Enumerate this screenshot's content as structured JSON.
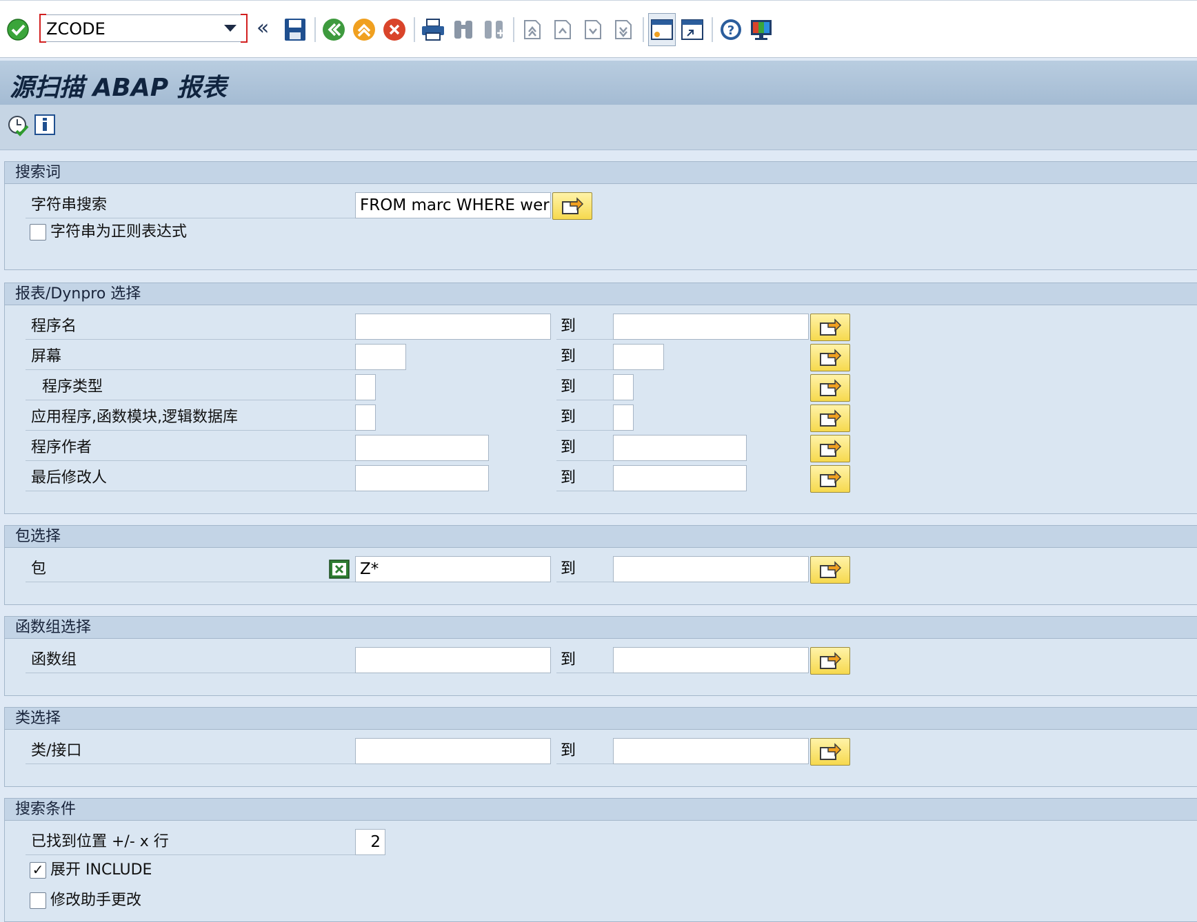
{
  "toolbar": {
    "command_value": "ZCODE",
    "icons": [
      "enter-icon",
      "save-icon",
      "back-icon",
      "exit-icon",
      "cancel-icon",
      "print-icon",
      "find-icon",
      "find-next-icon",
      "first-page-icon",
      "previous-page-icon",
      "next-page-icon",
      "last-page-icon",
      "create-session-icon",
      "shortcut-icon",
      "help-icon",
      "customize-layout-icon"
    ]
  },
  "title": "源扫描 ABAP 报表",
  "app_toolbar": {
    "icons": [
      "execute-icon",
      "information-icon"
    ]
  },
  "groups": {
    "search_terms": {
      "title": "搜索词",
      "string_search_label": "字符串搜索",
      "string_search_value": "FROM marc WHERE wer…",
      "regex_label": "字符串为正则表达式",
      "regex_checked": false
    },
    "report_selection": {
      "title": "报表/Dynpro 选择",
      "to_label": "到",
      "rows": [
        {
          "label": "程序名",
          "from": "",
          "to": ""
        },
        {
          "label": "屏幕",
          "from": "",
          "to": ""
        },
        {
          "label": "程序类型",
          "from": "",
          "to": ""
        },
        {
          "label": "应用程序,函数模块,逻辑数据库",
          "from": "",
          "to": ""
        },
        {
          "label": "程序作者",
          "from": "",
          "to": ""
        },
        {
          "label": "最后修改人",
          "from": "",
          "to": ""
        }
      ]
    },
    "package_selection": {
      "title": "包选择",
      "label": "包",
      "from": "Z*",
      "to": "",
      "to_label": "到"
    },
    "function_group_selection": {
      "title": "函数组选择",
      "label": "函数组",
      "from": "",
      "to": "",
      "to_label": "到"
    },
    "class_selection": {
      "title": "类选择",
      "label": "类/接口",
      "from": "",
      "to": "",
      "to_label": "到"
    },
    "search_conditions": {
      "title": "搜索条件",
      "lines_label": "已找到位置 +/- x 行",
      "lines_value": "2",
      "expand_include_label": "展开 INCLUDE",
      "expand_include_checked": true,
      "modification_label": "修改助手更改",
      "modification_checked": false
    }
  },
  "colors": {
    "background": "#dfe9f5",
    "group_header": "#c3d4e6",
    "title_bar": "#a4bbd3",
    "multi_select_button": "#f6d94e",
    "check_green": "#2e9b2e",
    "cancel_red": "#d9442a"
  }
}
